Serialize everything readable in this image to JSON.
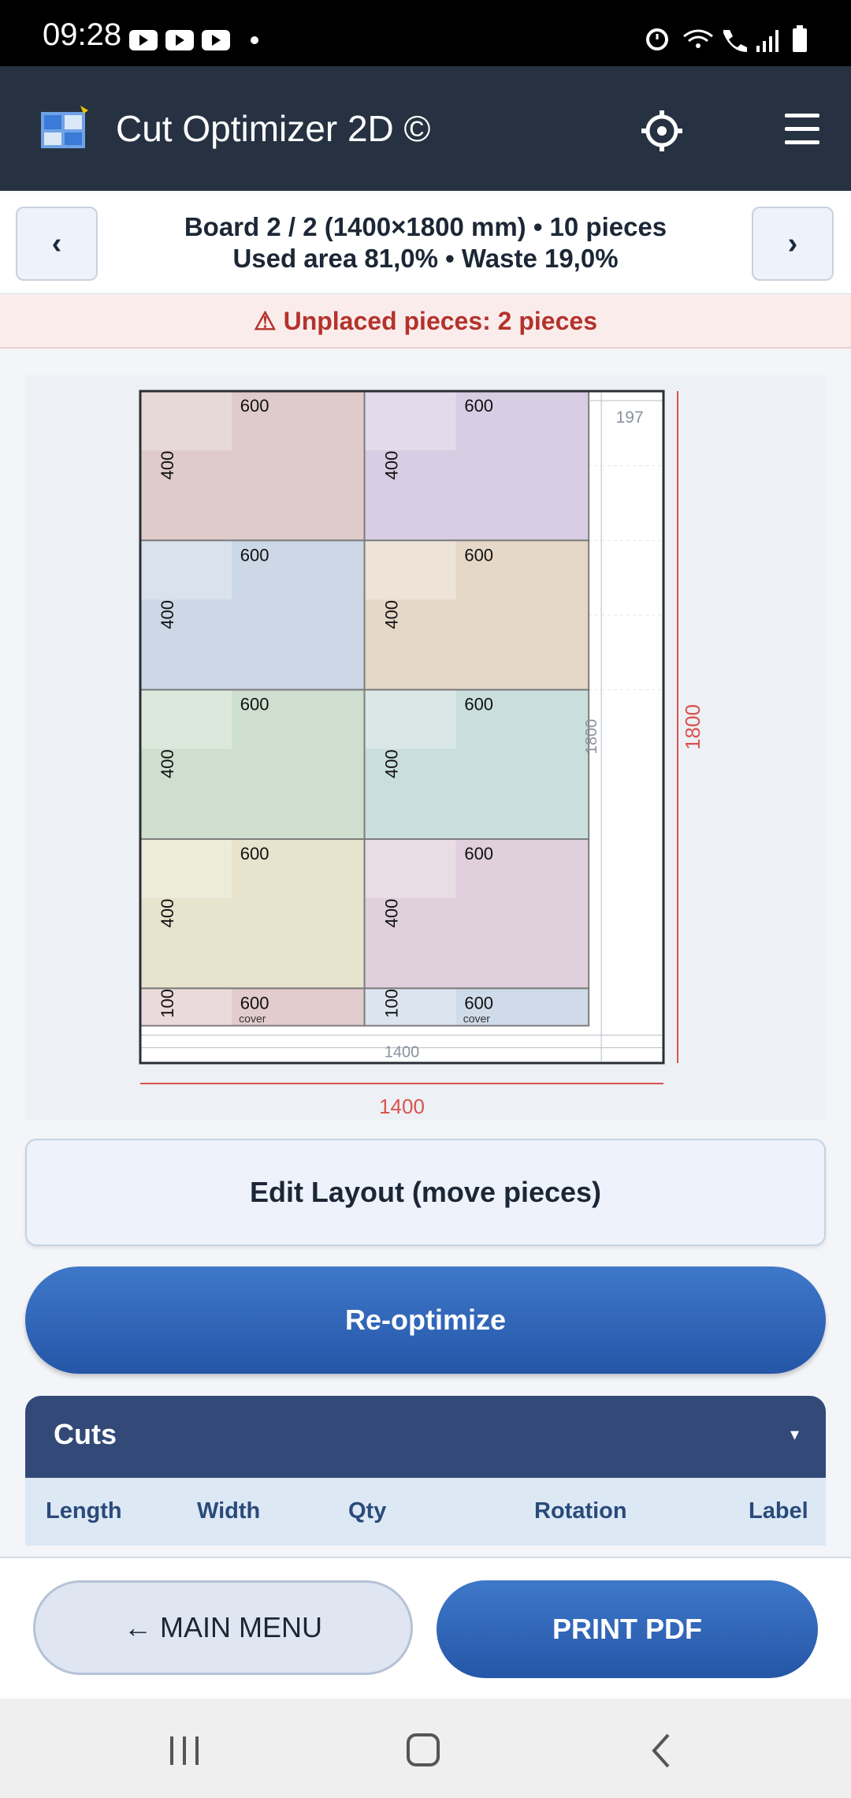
{
  "status_bar": {
    "time": "09:28"
  },
  "app_bar": {
    "title": "Cut Optimizer 2D ©"
  },
  "board_nav": {
    "prev_label": "‹",
    "next_label": "›",
    "line1": "Board 2 / 2 (1400×1800 mm)  •  10 pieces",
    "line2": "Used area 81,0%  •  Waste 19,0%"
  },
  "warning": {
    "text": "⚠ Unplaced pieces: 2 pieces"
  },
  "layout": {
    "board_width": "1400",
    "board_height": "1800",
    "waste_width": "197",
    "pieces": [
      {
        "w": "600",
        "h": "400",
        "color": "#e0cbcb"
      },
      {
        "w": "600",
        "h": "400",
        "color": "#d8cde3"
      },
      {
        "w": "600",
        "h": "400",
        "color": "#ccd8e6"
      },
      {
        "w": "600",
        "h": "400",
        "color": "#e6d8c8"
      },
      {
        "w": "600",
        "h": "400",
        "color": "#cfdfcf"
      },
      {
        "w": "600",
        "h": "400",
        "color": "#cbdede"
      },
      {
        "w": "600",
        "h": "400",
        "color": "#e7e3cc"
      },
      {
        "w": "600",
        "h": "400",
        "color": "#e0cfdc"
      },
      {
        "w": "600",
        "h": "100",
        "color": "#e3cccd",
        "label": "cover"
      },
      {
        "w": "600",
        "h": "100",
        "color": "#cfdbe9",
        "label": "cover"
      }
    ]
  },
  "buttons": {
    "edit_layout": "Edit Layout (move pieces)",
    "reoptimize": "Re-optimize",
    "main_menu": "← MAIN MENU",
    "print_pdf": "PRINT PDF"
  },
  "cuts": {
    "title": "Cuts",
    "toggle": "▾",
    "columns": [
      "Length",
      "Width",
      "Qty",
      "Rotation",
      "Label"
    ]
  }
}
